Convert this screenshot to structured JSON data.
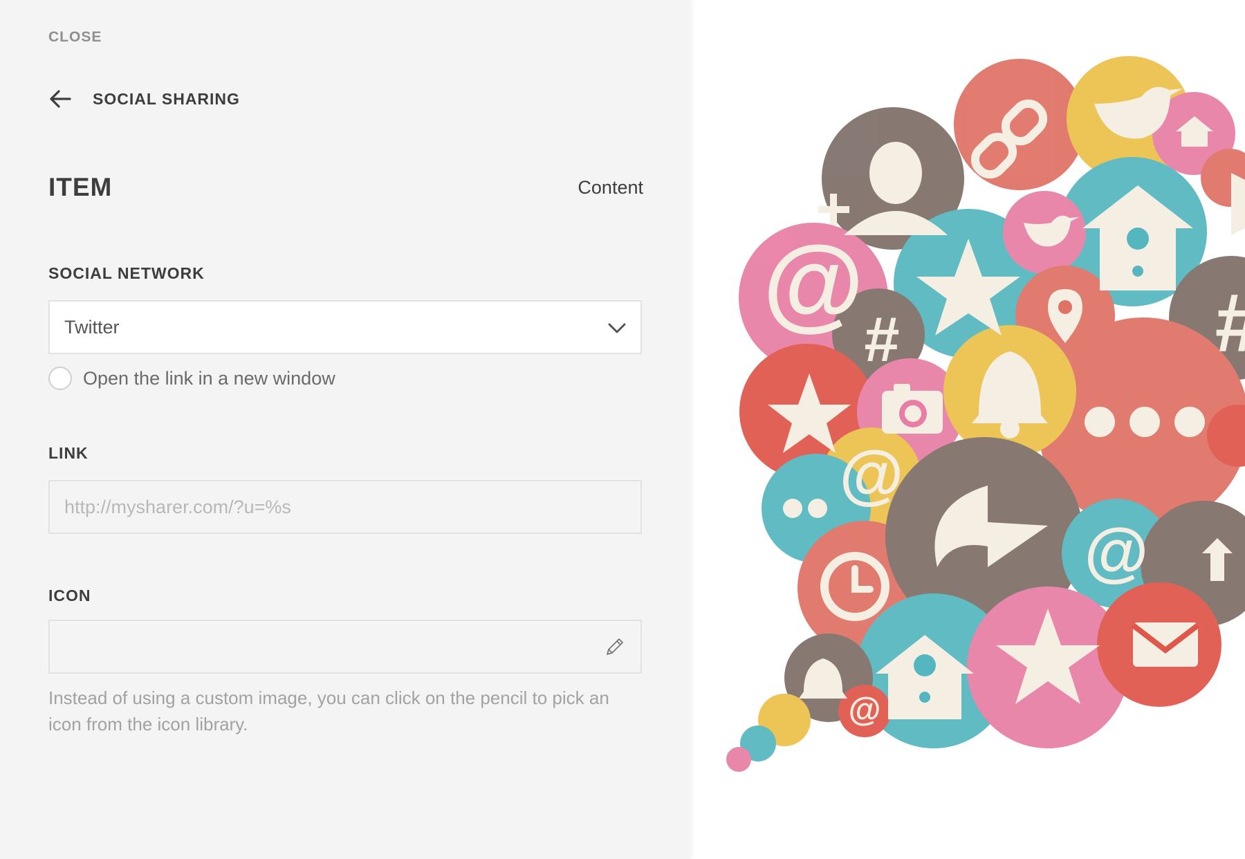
{
  "panel": {
    "close_label": "CLOSE",
    "back_title": "SOCIAL SHARING",
    "item_title": "ITEM",
    "content_tab": "Content"
  },
  "social_network": {
    "label": "SOCIAL NETWORK",
    "selected": "Twitter",
    "new_window_label": "Open the link in a new window",
    "new_window_checked": false
  },
  "link": {
    "label": "LINK",
    "value": "",
    "placeholder": "http://mysharer.com/?u=%s"
  },
  "icon": {
    "label": "ICON",
    "help": "Instead of using a custom image, you can click on the pencil to pick an icon from the icon library."
  },
  "illustration": {
    "icons": [
      "user-plus-icon",
      "link-icon",
      "twitter-icon",
      "birdhouse-icon",
      "at-icon",
      "hashtag-icon",
      "star-icon",
      "map-pin-icon",
      "camera-icon",
      "bell-icon",
      "ellipsis-icon",
      "share-arrow-icon",
      "clock-icon",
      "mail-icon",
      "chat-dots-icon",
      "play-icon"
    ],
    "colors": {
      "red": "#e07265",
      "brown": "#7e6f68",
      "yellow": "#ecc04a",
      "pink": "#e87ea5",
      "teal": "#55b6bf",
      "cream": "#f5efe3"
    }
  }
}
